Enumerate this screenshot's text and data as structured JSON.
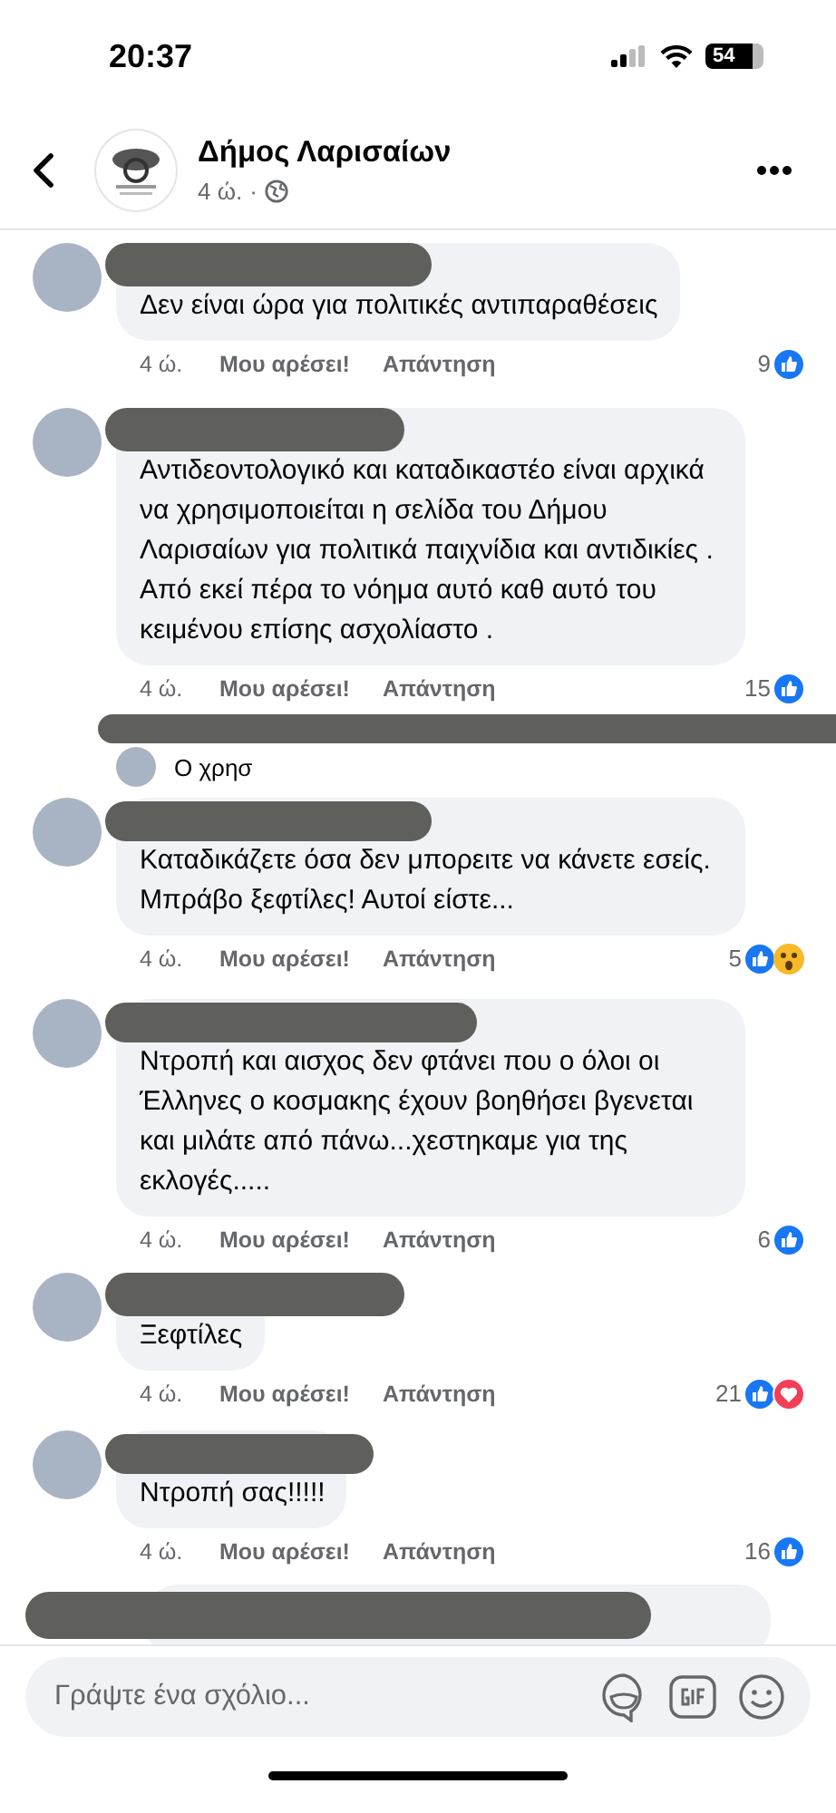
{
  "status_bar": {
    "time": "20:37",
    "battery": "54"
  },
  "header": {
    "title": "Δήμος Λαρισαίων",
    "time": "4 ώ.",
    "dot": "·"
  },
  "comments": [
    {
      "redacted": true,
      "text": "Δεν είναι ώρα για πολιτικές αντιπαραθέσεις",
      "time": "4 ώ.",
      "like": "Μου αρέσει!",
      "reply": "Απάντηση",
      "count": "9",
      "reactions": [
        {
          "kind": "like"
        }
      ]
    },
    {
      "redacted": true,
      "text": "Αντιδεοντολογικό και καταδικαστέο είναι αρχικά να χρησιμοποιείται η σελίδα του Δήμου Λαρισαίων για πολιτικά παιχνίδια και αντιδικίες . Από εκεί πέρα το νόημα αυτό καθ αυτό του κειμένου επίσης ασχολίαστο .",
      "time": "4 ώ.",
      "like": "Μου αρέσει!",
      "reply": "Απάντηση",
      "count": "15",
      "reactions": [
        {
          "kind": "like"
        }
      ],
      "reply_preview": {
        "redacted": true,
        "text": "Ο χρησ"
      }
    },
    {
      "redacted": true,
      "text": "Καταδικάζετε όσα δεν μπορειτε να κάνετε εσείς. Μπράβο ξεφτίλες! Αυτοί είστε...",
      "time": "4 ώ.",
      "like": "Μου αρέσει!",
      "reply": "Απάντηση",
      "count": "5",
      "reactions": [
        {
          "kind": "like"
        },
        {
          "kind": "wow"
        }
      ]
    },
    {
      "redacted": true,
      "text": "Ντροπή και αισχος δεν φτάνει που ο όλοι οι Έλληνες ο κοσμακης έχουν βοηθήσει βγενεται και μιλάτε από πάνω...χεστηκαμε για της εκλογές.....",
      "time": "4 ώ.",
      "like": "Μου αρέσει!",
      "reply": "Απάντηση",
      "count": "6",
      "reactions": [
        {
          "kind": "like"
        }
      ]
    },
    {
      "redacted": true,
      "text": "Ξεφτίλες",
      "time": "4 ώ.",
      "like": "Μου αρέσει!",
      "reply": "Απάντηση",
      "count": "21",
      "reactions": [
        {
          "kind": "like"
        },
        {
          "kind": "love"
        }
      ]
    },
    {
      "redacted": true,
      "text": "Ντροπή σας!!!!!",
      "time": "4 ώ.",
      "like": "Μου αρέσει!",
      "reply": "Απάντηση",
      "count": "16",
      "reactions": [
        {
          "kind": "like"
        }
      ]
    }
  ],
  "cut_off_comment": {
    "redacted": true
  },
  "composer": {
    "placeholder": "Γράψτε ένα σχόλιο..."
  }
}
